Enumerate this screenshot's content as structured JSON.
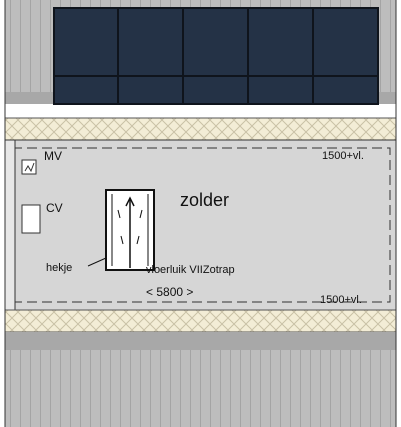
{
  "room": {
    "name": "zolder",
    "width_label": "< 5800 >",
    "ceiling_height_top": "1500+vl.",
    "ceiling_height_bottom": "1500+vl."
  },
  "labels": {
    "mv": "MV",
    "cv": "CV",
    "railing": "hekje",
    "hatch_stair": "vloerluik VIIZotrap"
  },
  "colors": {
    "solar_panel": "#243246",
    "solar_frame": "#0f141c",
    "roof_tile": "#bdbdbd",
    "roof_stripe": "#8a8a8a",
    "insulation": "#f3edd6",
    "floor": "#d6d6d6",
    "wall": "#e7e7e7"
  }
}
